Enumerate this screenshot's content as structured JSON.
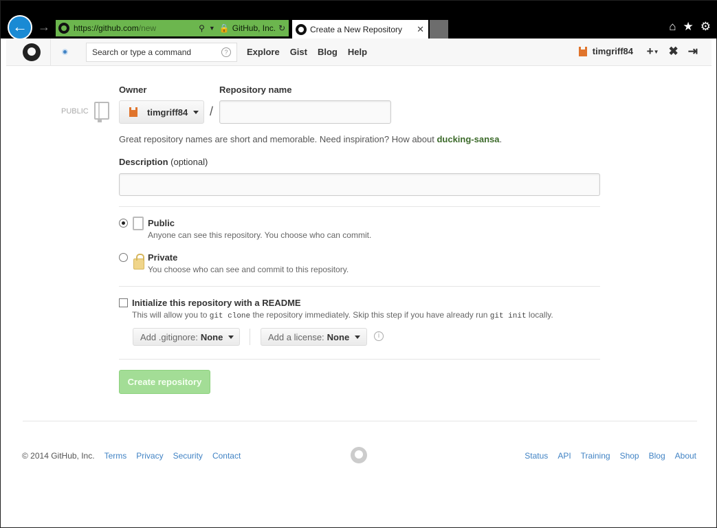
{
  "browser": {
    "url_prefix": "https://",
    "url_host": "github.com",
    "url_path": "/new",
    "site_identity": "GitHub, Inc.",
    "tab_title": "Create a New Repository"
  },
  "header": {
    "search_placeholder": "Search or type a command",
    "nav": [
      "Explore",
      "Gist",
      "Blog",
      "Help"
    ],
    "username": "timgriff84"
  },
  "form": {
    "public_tag": "PUBLIC",
    "owner_label": "Owner",
    "owner_value": "timgriff84",
    "repo_name_label": "Repository name",
    "repo_name_value": "",
    "hint_text": "Great repository names are short and memorable. Need inspiration? How about ",
    "hint_suggestion": "ducking-sansa",
    "hint_end": ".",
    "description_label": "Description",
    "description_optional": "(optional)",
    "description_value": "",
    "public_title": "Public",
    "public_desc": "Anyone can see this repository. You choose who can commit.",
    "private_title": "Private",
    "private_desc": "You choose who can see and commit to this repository.",
    "readme_label": "Initialize this repository with a README",
    "readme_desc_1": "This will allow you to ",
    "readme_code_1": "git clone",
    "readme_desc_2": " the repository immediately. Skip this step if you have already run ",
    "readme_code_2": "git init",
    "readme_desc_3": " locally.",
    "gitignore_label": "Add .gitignore:",
    "gitignore_value": "None",
    "license_label": "Add a license:",
    "license_value": "None",
    "create_button": "Create repository",
    "visibility_selected": "public",
    "readme_checked": false
  },
  "footer": {
    "copyright": "© 2014 GitHub, Inc.",
    "left_links": [
      "Terms",
      "Privacy",
      "Security",
      "Contact"
    ],
    "right_links": [
      "Status",
      "API",
      "Training",
      "Shop",
      "Blog",
      "About"
    ]
  },
  "colors": {
    "link": "#4183c4",
    "create_button_bg": "#a3dd96",
    "suggestion": "#3c6a2a",
    "address_bar": "#6cb64e"
  }
}
